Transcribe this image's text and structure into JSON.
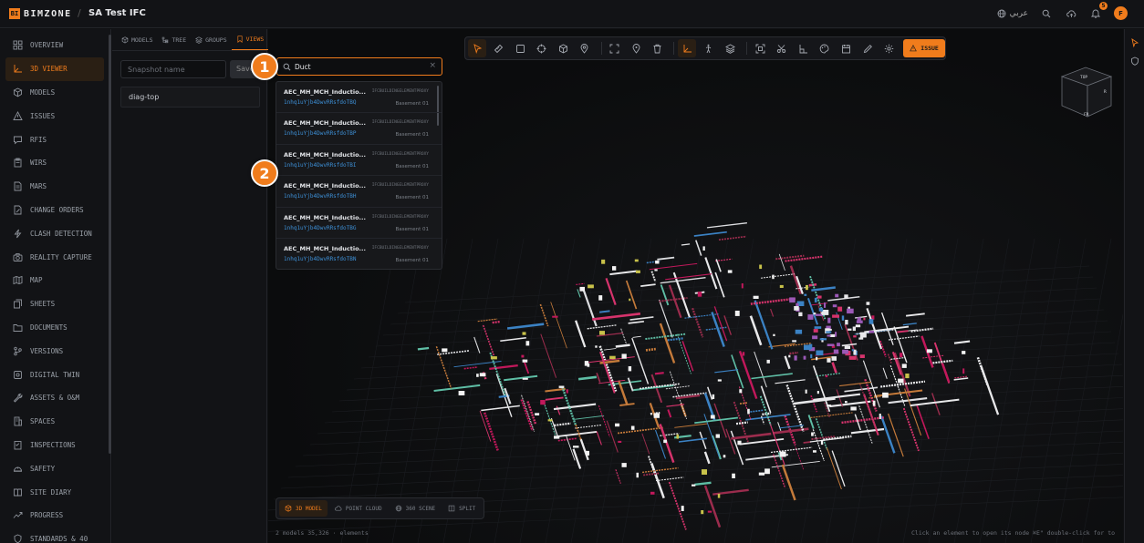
{
  "app": {
    "logo_mark": "BI",
    "logo_text": "BIMZONE",
    "separator": "/",
    "project": "SA Test IFC"
  },
  "topbar": {
    "language": "عربي",
    "notification_count": "5",
    "avatar_initial": "F"
  },
  "sidebar": {
    "items": [
      {
        "label": "OVERVIEW",
        "icon": "grid-icon"
      },
      {
        "label": "3D VIEWER",
        "icon": "axis-icon",
        "active": true
      },
      {
        "label": "MODELS",
        "icon": "cubes-icon"
      },
      {
        "label": "ISSUES",
        "icon": "warning-icon"
      },
      {
        "label": "RFIS",
        "icon": "chat-icon"
      },
      {
        "label": "WIRS",
        "icon": "clipboard-icon"
      },
      {
        "label": "MARS",
        "icon": "doc-icon"
      },
      {
        "label": "CHANGE ORDERS",
        "icon": "doc-edit-icon"
      },
      {
        "label": "CLASH DETECTION",
        "icon": "bolt-icon"
      },
      {
        "label": "REALITY CAPTURE",
        "icon": "camera-icon"
      },
      {
        "label": "MAP",
        "icon": "map-icon"
      },
      {
        "label": "SHEETS",
        "icon": "sheets-icon"
      },
      {
        "label": "DOCUMENTS",
        "icon": "folder-icon"
      },
      {
        "label": "VERSIONS",
        "icon": "branch-icon"
      },
      {
        "label": "DIGITAL TWIN",
        "icon": "twin-icon"
      },
      {
        "label": "ASSETS & O&M",
        "icon": "wrench-icon"
      },
      {
        "label": "SPACES",
        "icon": "building-icon"
      },
      {
        "label": "INSPECTIONS",
        "icon": "checklist-icon"
      },
      {
        "label": "SAFETY",
        "icon": "helmet-icon"
      },
      {
        "label": "SITE DIARY",
        "icon": "book-icon"
      },
      {
        "label": "PROGRESS",
        "icon": "trend-icon"
      },
      {
        "label": "STANDARDS & 40",
        "icon": "shield-icon"
      }
    ]
  },
  "panel": {
    "tabs": [
      {
        "label": "MODELS",
        "icon": "cubes-icon"
      },
      {
        "label": "TREE",
        "icon": "tree-icon"
      },
      {
        "label": "GROUPS",
        "icon": "layers-icon"
      },
      {
        "label": "VIEWS",
        "icon": "bookmark-icon",
        "active": true
      }
    ],
    "snapshot_placeholder": "Snapshot name",
    "save_label": "Save",
    "views": [
      "diag-top"
    ]
  },
  "toolbar": {
    "tools": [
      "select-icon",
      "measure-icon",
      "box-icon",
      "target-icon",
      "cube-icon",
      "pin-icon",
      "|",
      "fit-icon",
      "location-icon",
      "trash-icon",
      "|",
      "axis-icon",
      "walk-icon",
      "layers-icon",
      "|",
      "fullscreen-icon",
      "scissors-icon",
      "dimension-icon",
      "palette-icon",
      "calendar-icon",
      "pencil-icon",
      "gear-icon"
    ],
    "active_tools": [
      "select-icon",
      "axis-icon"
    ],
    "issue_label": "ISSUE"
  },
  "search": {
    "value": "Duct",
    "results": [
      {
        "name": "AEC_MH_MCH_Inductio...",
        "type": "IFCBUILDINGELEMENTPROXY",
        "id": "1nhq1uYjb4DwvRRsfdoTBQ",
        "level": "Basement 01"
      },
      {
        "name": "AEC_MH_MCH_Inductio...",
        "type": "IFCBUILDINGELEMENTPROXY",
        "id": "1nhq1uYjb4DwvRRsfdoTBP",
        "level": "Basement 01"
      },
      {
        "name": "AEC_MH_MCH_Inductio...",
        "type": "IFCBUILDINGELEMENTPROXY",
        "id": "1nhq1uYjb4DwvRRsfdoTBI",
        "level": "Basement 01"
      },
      {
        "name": "AEC_MH_MCH_Inductio...",
        "type": "IFCBUILDINGELEMENTPROXY",
        "id": "1nhq1uYjb4DwvRRsfdoTBH",
        "level": "Basement 01"
      },
      {
        "name": "AEC_MH_MCH_Inductio...",
        "type": "IFCBUILDINGELEMENTPROXY",
        "id": "1nhq1uYjb4DwvRRsfdoTBG",
        "level": "Basement 01"
      },
      {
        "name": "AEC_MH_MCH_Inductio...",
        "type": "IFCBUILDINGELEMENTPROXY",
        "id": "1nhq1uYjb4DwvRRsfdoTBN",
        "level": "Basement 01"
      }
    ]
  },
  "steps": [
    "1",
    "2"
  ],
  "viewcube": {
    "top": "TOP",
    "front": "FR",
    "right": "R"
  },
  "modes": [
    {
      "label": "3D MODEL",
      "active": true
    },
    {
      "label": "POINT CLOUD"
    },
    {
      "label": "360 SCENE"
    },
    {
      "label": "SPLIT"
    }
  ],
  "status": {
    "stats": "2 models 35,326 · elements",
    "hint": "Click an element to open its node ⌘E\" double-click for to"
  },
  "colors": {
    "accent": "#f07c1c",
    "link": "#3d8fd6",
    "background": "#0f1012"
  }
}
